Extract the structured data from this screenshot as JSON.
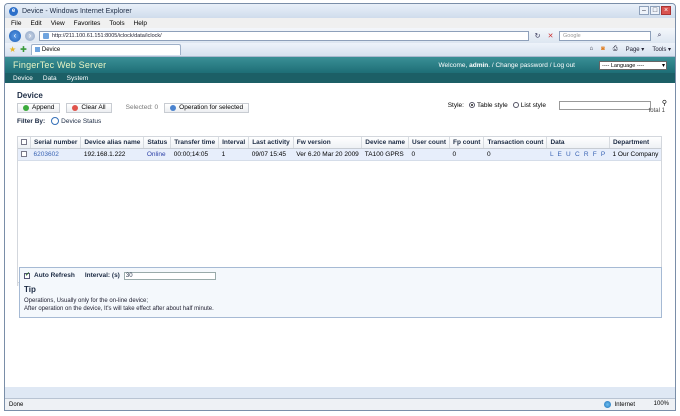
{
  "browser": {
    "window_title": "Device - Windows Internet Explorer",
    "menu": [
      "File",
      "Edit",
      "View",
      "Favorites",
      "Tools",
      "Help"
    ],
    "url": "http://211.100.61.151:8005/iclock/data/iclock/",
    "search_placeholder": "Google",
    "tab_title": "Device",
    "tools": [
      "Page ▾",
      "Tools ▾"
    ],
    "status": "Done",
    "zone": "Internet",
    "zoom": "100%"
  },
  "app": {
    "brand": "FingerTec Web Server",
    "welcome_prefix": "Welcome, ",
    "username": "admin",
    "user_links": ". / Change password / Log out",
    "language": "---- Language ----",
    "nav": [
      "Device",
      "Data",
      "System"
    ]
  },
  "device": {
    "title": "Device",
    "style_label": "Style:",
    "style_table": "Table style",
    "style_list": "List style",
    "total": "total 1",
    "append": "Append",
    "clear_all": "Clear All",
    "selected": "Selected: 0",
    "operation": "Operation for selected",
    "filter_by": "Filter By:",
    "device_status": "Device Status"
  },
  "table": {
    "headers": [
      "Serial number",
      "Device alias name",
      "Status",
      "Transfer time",
      "Interval",
      "Last activity",
      "Fw version",
      "Device name",
      "User count",
      "Fp count",
      "Transaction count",
      "Data",
      "Department"
    ],
    "rows": [
      [
        "6203602",
        "192.168.1.222",
        "Online",
        "00:00;14:05",
        "1",
        "09/07 15:45",
        "Ver 6.20 Mar 20 2009",
        "TA100 GPRS",
        "0",
        "0",
        "0",
        "L E U C R F P",
        "1 Our Company"
      ]
    ]
  },
  "panel": {
    "auto_refresh": "Auto Refresh",
    "interval_label": "Interval: (s)",
    "interval_value": "30",
    "tip_title": "Tip",
    "tip_line1": "Operations, Usually only for the on-line device;",
    "tip_line2": "After operation on the device, It's will take effect after about half minute."
  },
  "colors": {
    "header_bg": "#1e6e76",
    "brand_text": "#e7f4c4",
    "row_bg": "#e7eefb",
    "link": "#3a64b4"
  }
}
